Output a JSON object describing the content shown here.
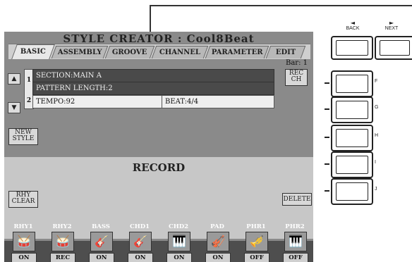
{
  "title": "STYLE CREATOR : Cool8Beat",
  "tabs": [
    "BASIC",
    "ASSEMBLY",
    "GROOVE",
    "CHANNEL",
    "PARAMETER",
    "EDIT"
  ],
  "bar_label": "Bar:   1",
  "up_glyph": "▲",
  "down_glyph": "▼",
  "list": {
    "row1_num": "1",
    "row2_num": "2",
    "section": "SECTION:MAIN A",
    "pattern_length": "PATTERN LENGTH:2",
    "tempo": "TEMPO:92",
    "beat": "BEAT:4/4"
  },
  "buttons": {
    "rec_ch_1": "REC",
    "rec_ch_2": "CH",
    "new_style_1": "NEW",
    "new_style_2": "STYLE",
    "rhy_clear_1": "RHY",
    "rhy_clear_2": "CLEAR",
    "delete": "DELETE"
  },
  "record_label": "RECORD",
  "parts": [
    {
      "name": "RHY1",
      "status": "ON",
      "icon": "🥁"
    },
    {
      "name": "RHY2",
      "status": "REC",
      "icon": "🥁"
    },
    {
      "name": "BASS",
      "status": "ON",
      "icon": "🎸"
    },
    {
      "name": "CHD1",
      "status": "ON",
      "icon": "🎸"
    },
    {
      "name": "CHD2",
      "status": "ON",
      "icon": "🎹"
    },
    {
      "name": "PAD",
      "status": "ON",
      "icon": "🎻"
    },
    {
      "name": "PHR1",
      "status": "OFF",
      "icon": "🎺"
    },
    {
      "name": "PHR2",
      "status": "OFF",
      "icon": "🎹"
    }
  ],
  "hardware": {
    "back_label": "BACK",
    "next_label": "NEXT",
    "back_arrow": "◄",
    "next_arrow": "►",
    "side_labels": [
      "F",
      "G",
      "H",
      "I",
      "J"
    ]
  },
  "colors": {
    "screen": "#8a8a8a",
    "selected_row": "#4a4a4a",
    "part_strip": "#4e4e4e"
  }
}
